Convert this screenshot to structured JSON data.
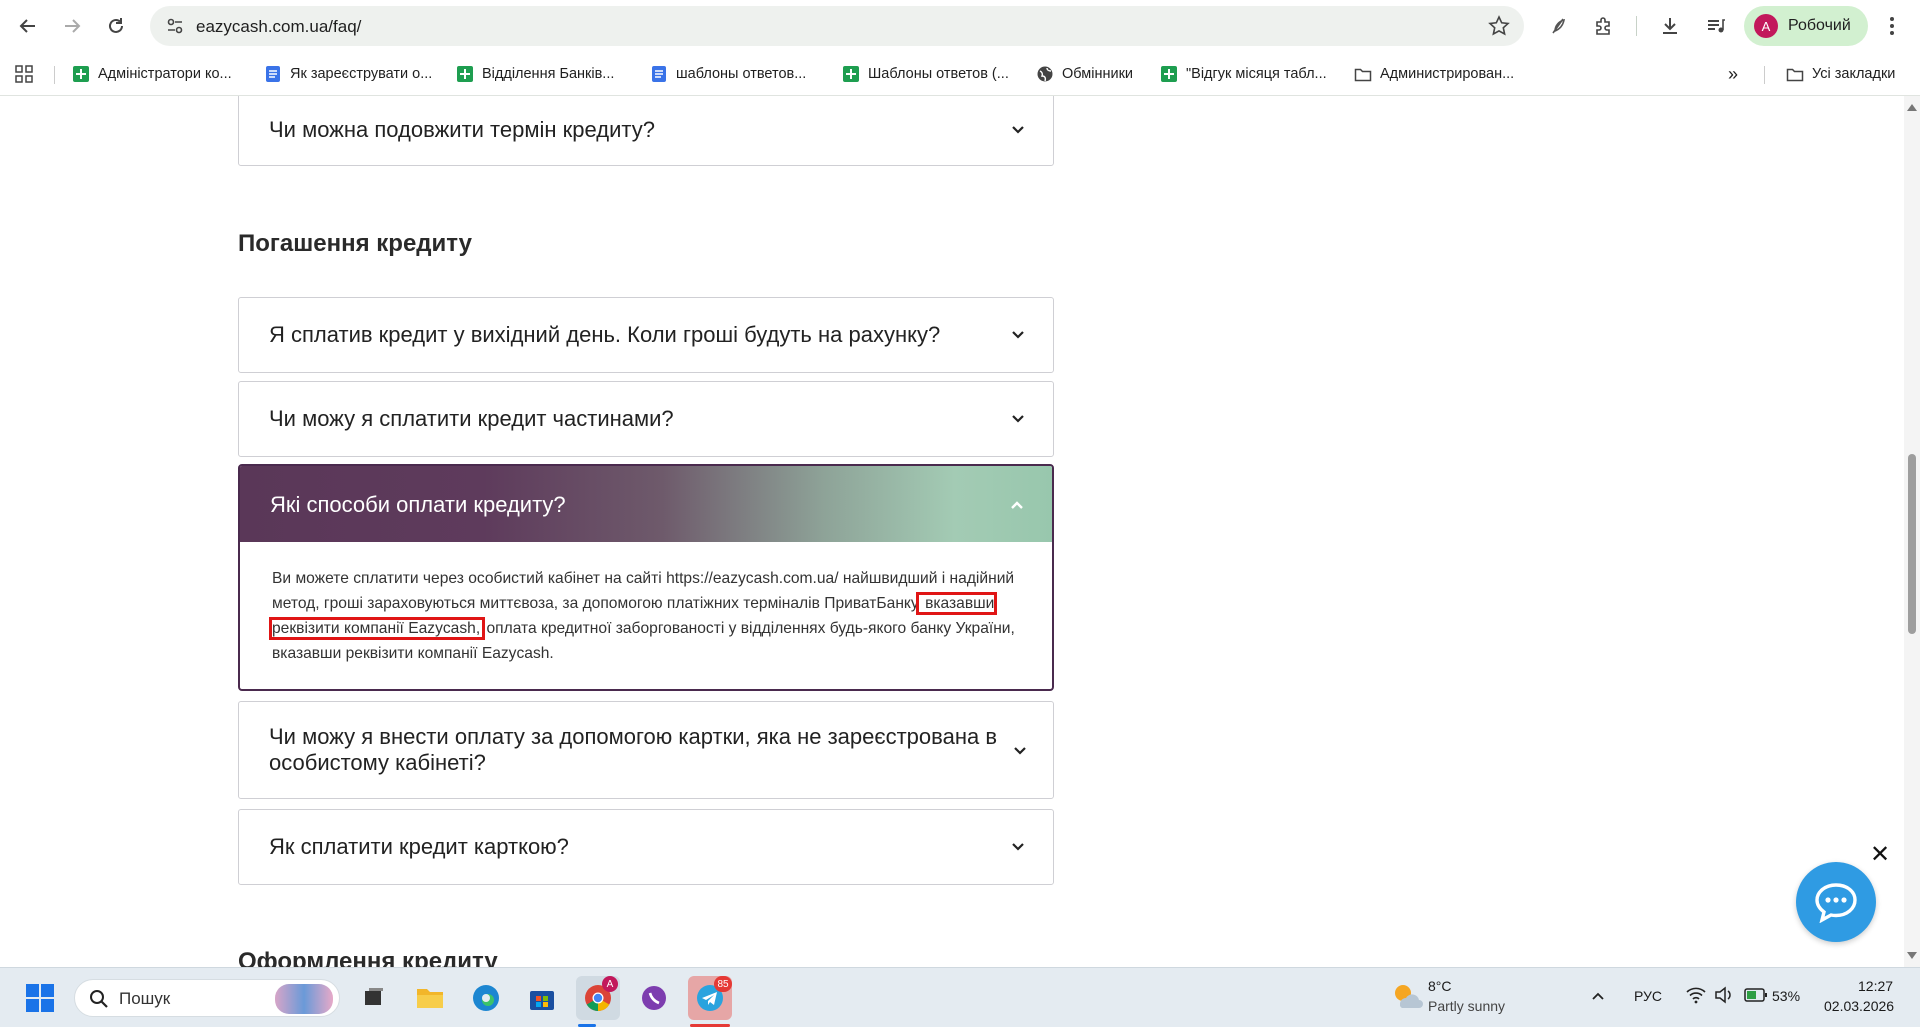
{
  "browser": {
    "url": "eazycash.com.ua/faq/",
    "profile_initial": "A",
    "profile_name": "Робочий"
  },
  "bookmarks": [
    {
      "label": "Адміністратори ко...",
      "icon": "sheets-icon"
    },
    {
      "label": "Як зареєструвати о...",
      "icon": "docs-icon"
    },
    {
      "label": "Відділення Банків...",
      "icon": "sheets-icon"
    },
    {
      "label": "шаблоны ответов...",
      "icon": "docs-icon"
    },
    {
      "label": "Шаблоны ответов (...",
      "icon": "sheets-icon"
    },
    {
      "label": "Обмінники",
      "icon": "globe-icon"
    },
    {
      "label": "\"Відгук місяця табл...",
      "icon": "sheets-icon"
    },
    {
      "label": "Администрирован...",
      "icon": "folder-icon"
    }
  ],
  "all_bookmarks_label": "Усі закладки",
  "faq": {
    "prev_question": "Чи можна подовжити термін кредиту?",
    "section_title": "Погашення кредиту",
    "questions": [
      "Я сплатив кредит у вихідний день. Коли гроші будуть на рахунку?",
      "Чи можу я сплатити кредит частинами?"
    ],
    "open": {
      "question": "Які способи оплати кредиту?",
      "answer_part1": "Ви можете сплатити через особистий кабінет на сайті https://eazycash.com.ua/ найшвидший і надійний метод, гроші зараховуються миттєвоза, за допомогою платіжних терміналів ПриватБанку",
      "answer_highlight": " вказавши реквізити компанії Eazycash,",
      "answer_part2": " оплата кредитної заборгованості у відділеннях будь-якого банку України, вказавши реквізити компанії Eazycash."
    },
    "questions_after": [
      "Чи можу я внести оплату за допомогою картки, яка не зареєстрована в особистому кабінеті?",
      "Як сплатити кредит карткою?"
    ],
    "next_section_title": "Оформлення кредиту"
  },
  "taskbar": {
    "search_placeholder": "Пошук",
    "telegram_badge": "85",
    "chrome_badge": "A",
    "weather_temp": "8°C",
    "weather_desc": "Partly sunny",
    "language": "РУС",
    "battery": "53%",
    "time": "12:27",
    "date": "02.03.2026"
  },
  "colors": {
    "accent_purple": "#5a3758",
    "accent_green": "#98c7ad",
    "highlight_red": "#e01515",
    "chat_blue": "#2f9be3"
  }
}
